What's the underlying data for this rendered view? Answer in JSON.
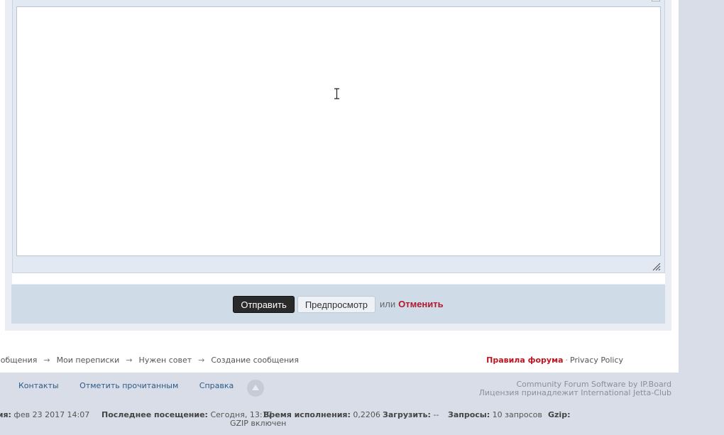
{
  "form": {
    "submit_label": "Отправить",
    "preview_label": "Предпросмотр",
    "or_text": "или",
    "cancel_label": "Отменить"
  },
  "breadcrumb": {
    "items": [
      "ообщения",
      "Мои переписки",
      "Нужен совет",
      "Создание сообщения"
    ],
    "separator": "→"
  },
  "rules": {
    "forum_rules": "Правила форума",
    "dot": "·",
    "privacy": "Privacy Policy"
  },
  "footer": {
    "links": [
      "Контакты",
      "Отметить прочитанным",
      "Справка"
    ],
    "credits_line1": "Community Forum Software by IP.Board",
    "credits_line2": "Лицензия принадлежит International Jetta-Club"
  },
  "stats": {
    "time_label": "емя:",
    "time_value": "фев 23 2017 14:07",
    "last_visit_label": "Последнее посещение:",
    "last_visit_value": "Сегодня, 13:17",
    "exec_label": "Время исполнения:",
    "exec_value": "0,2206",
    "load_label": "Загрузить:",
    "load_value": "--",
    "queries_label": "Запросы:",
    "queries_value": "10 запросов",
    "gzip_label": "Gzip:",
    "gzip_value": "GZIP включен"
  },
  "colors": {
    "cancel": "#b2182b",
    "rules": "#c4121f",
    "link": "#2b5c8a"
  }
}
